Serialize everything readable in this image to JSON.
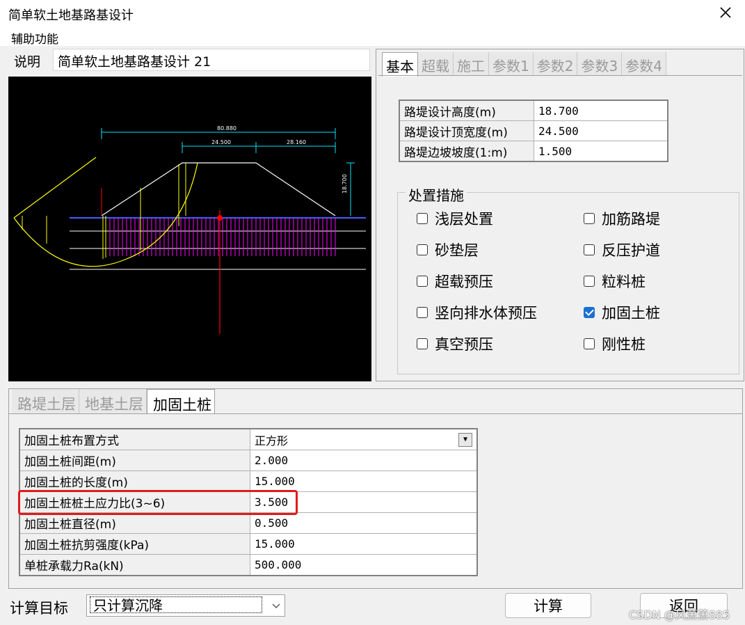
{
  "window": {
    "title": "简单软土地基路基设计"
  },
  "menu": {
    "items": [
      "辅助功能"
    ]
  },
  "description": {
    "label": "说明",
    "value": "简单软土地基路基设计 21"
  },
  "drawing": {
    "dims": [
      "80.880",
      "24.500",
      "28.160",
      "18.700"
    ],
    "colors": {
      "background": "#000000",
      "dim": "#00e5ff",
      "slip": "#ffff00",
      "piles": "#ff00ff",
      "axis": "#ff0000",
      "ground": "#ffffff"
    }
  },
  "right_tabs": [
    "基本",
    "超载",
    "施工",
    "参数1",
    "参数2",
    "参数3",
    "参数4"
  ],
  "basic_params": [
    {
      "key": "路堤设计高度(m)",
      "value": "18.700"
    },
    {
      "key": "路堤设计顶宽度(m)",
      "value": "24.500"
    },
    {
      "key": "路堤边坡坡度(1:m)",
      "value": "1.500"
    }
  ],
  "measures": {
    "label": "处置措施",
    "options": [
      {
        "label": "浅层处置",
        "checked": false
      },
      {
        "label": "加筋路堤",
        "checked": false
      },
      {
        "label": "砂垫层",
        "checked": false
      },
      {
        "label": "反压护道",
        "checked": false
      },
      {
        "label": "超载预压",
        "checked": false
      },
      {
        "label": "粒料桩",
        "checked": false
      },
      {
        "label": "竖向排水体预压",
        "checked": false
      },
      {
        "label": "加固土桩",
        "checked": true
      },
      {
        "label": "真空预压",
        "checked": false
      },
      {
        "label": "刚性桩",
        "checked": false
      }
    ]
  },
  "bottom_tabs": [
    "路堤土层",
    "地基土层",
    "加固土桩"
  ],
  "pile_params": [
    {
      "key": "加固土桩布置方式",
      "value": "正方形"
    },
    {
      "key": "加固土桩间距(m)",
      "value": "2.000"
    },
    {
      "key": "加固土桩的长度(m)",
      "value": "15.000"
    },
    {
      "key": "加固土桩桩土应力比(3~6)",
      "value": "3.500"
    },
    {
      "key": "加固土桩直径(m)",
      "value": "0.500"
    },
    {
      "key": "加固土桩抗剪强度(kPa)",
      "value": "15.000"
    },
    {
      "key": "单桩承载力Ra(kN)",
      "value": "500.000"
    }
  ],
  "calc_target": {
    "label": "计算目标",
    "value": "只计算沉降"
  },
  "buttons": {
    "calculate": "计算",
    "back": "返回"
  },
  "watermark": "CSDN @风萧萧885",
  "highlight_color": "#e01b1b"
}
